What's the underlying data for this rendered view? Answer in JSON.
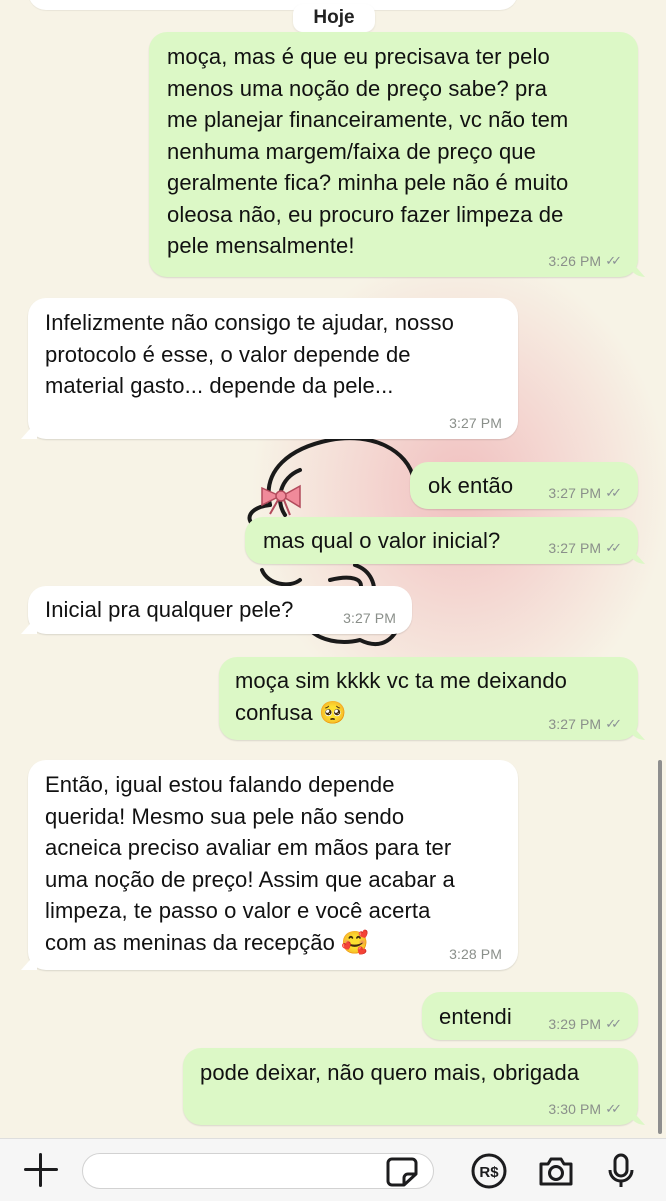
{
  "date_divider": "Hoje",
  "messages": [
    {
      "direction": "outgoing",
      "text": "moça, mas é que eu precisava ter pelo\nmenos uma noção de preço sabe? pra\nme planejar financeiramente, vc não tem\nnenhuma margem/faixa de preço que\ngeralmente fica? minha pele não é muito\noleosa não, eu procuro fazer limpeza de\npele mensalmente!",
      "time": "3:26 PM",
      "status": "read"
    },
    {
      "direction": "incoming",
      "text": "Infelizmente não consigo te ajudar, nosso\nprotocolo é esse, o valor depende de\nmaterial gasto... depende da pele...",
      "time": "3:27 PM"
    },
    {
      "direction": "outgoing",
      "text": "ok então",
      "time": "3:27 PM",
      "status": "read"
    },
    {
      "direction": "outgoing",
      "text": "mas qual o valor inicial?",
      "time": "3:27 PM",
      "status": "read"
    },
    {
      "direction": "incoming",
      "text": "Inicial pra qualquer pele?",
      "time": "3:27 PM"
    },
    {
      "direction": "outgoing",
      "text": "moça sim kkkk vc ta me deixando\nconfusa 🥺",
      "time": "3:27 PM",
      "status": "read"
    },
    {
      "direction": "incoming",
      "text": "Então, igual estou falando depende\nquerida! Mesmo sua pele não sendo\nacneica preciso avaliar em mãos para ter\numa noção de preço! Assim que acabar a\nlimpeza, te passo o valor e você acerta\ncom as meninas da recepção 🥰",
      "time": "3:28 PM"
    },
    {
      "direction": "outgoing",
      "text": "entendi",
      "time": "3:29 PM",
      "status": "read"
    },
    {
      "direction": "outgoing",
      "text": "pode deixar, não quero mais, obrigada",
      "time": "3:30 PM",
      "status": "read"
    }
  ],
  "read_receipt": "✓✓",
  "input": {
    "placeholder": "",
    "value": ""
  },
  "input_bar_icons": [
    "plus-icon",
    "sticker-icon",
    "pix-payment-icon",
    "camera-icon",
    "microphone-icon"
  ],
  "payment_icon_label": "R$",
  "colors": {
    "outgoing_bubble": "#dcf8c6",
    "incoming_bubble": "#ffffff",
    "background": "#f7f3e6"
  }
}
